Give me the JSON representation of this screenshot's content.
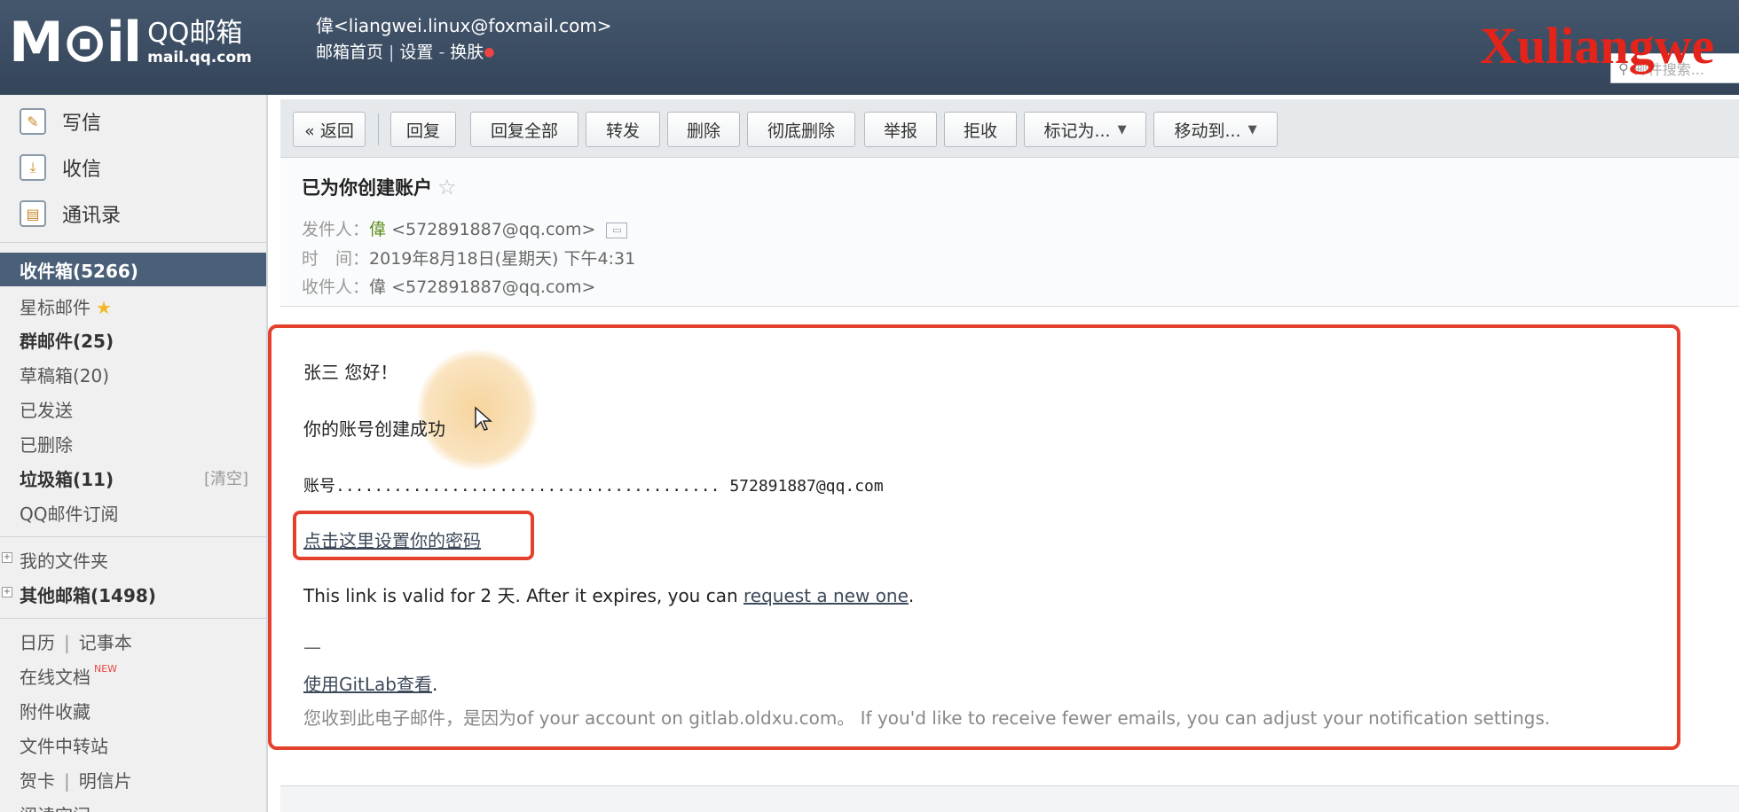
{
  "header": {
    "logo_text": "M⊙il",
    "brand_name": "QQ邮箱",
    "brand_url": "mail.qq.com",
    "account": "偉<liangwei.linux@foxmail.com>",
    "links": [
      "邮箱首页",
      "设置",
      "换肤"
    ],
    "watermark": "Xuliangwe",
    "search_placeholder": "邮件搜索..."
  },
  "sidebar": {
    "quick_actions": [
      {
        "label": "写信",
        "icon": "compose-icon"
      },
      {
        "label": "收信",
        "icon": "receive-icon"
      },
      {
        "label": "通讯录",
        "icon": "contacts-icon"
      }
    ],
    "folders": [
      {
        "label": "收件箱(5266)"
      },
      {
        "label": "星标邮件"
      },
      {
        "label": "群邮件(25)"
      },
      {
        "label": "草稿箱(20)"
      },
      {
        "label": "已发送"
      },
      {
        "label": "已删除"
      },
      {
        "label": "垃圾箱(11)",
        "action": "[清空]"
      },
      {
        "label": "QQ邮件订阅"
      }
    ],
    "groups": [
      {
        "label": "我的文件夹"
      },
      {
        "label": "其他邮箱(1498)"
      }
    ],
    "tools": {
      "calendar": "日历",
      "notebook": "记事本",
      "docs": "在线文档",
      "new_badge": "NEW",
      "attachments": "附件收藏",
      "transfer": "文件中转站",
      "greeting": "贺卡",
      "postcard": "明信片",
      "reading": "阅读空间"
    }
  },
  "toolbar": {
    "buttons": [
      "« 返回",
      "回复",
      "回复全部",
      "转发",
      "删除",
      "彻底删除",
      "举报",
      "拒收",
      "标记为...",
      "移动到..."
    ]
  },
  "mail": {
    "subject": "已为你创建账户",
    "from_label": "发件人：",
    "from_name": "偉",
    "from_addr": "<572891887@qq.com>",
    "time_label": "时　间：",
    "time_value": "2019年8月18日(星期天) 下午4:31",
    "to_label": "收件人：",
    "to_name": "偉",
    "to_addr": "<572891887@qq.com>"
  },
  "body": {
    "greeting": "张三 您好！",
    "created": "你的账号创建成功",
    "account_line": "账号........................................ 572891887@qq.com",
    "set_password_link": "点击这里设置你的密码",
    "validity_prefix": "This link is valid for 2 天. After it expires, you can ",
    "request_link": "request a new one",
    "validity_suffix": ".",
    "dash": "—",
    "gitlab_link": "使用GitLab查看",
    "gitlab_suffix": ".",
    "footer": "您收到此电子邮件，是因为of your account on gitlab.oldxu.com。 If you'd like to receive fewer emails, you can adjust your notification settings."
  }
}
